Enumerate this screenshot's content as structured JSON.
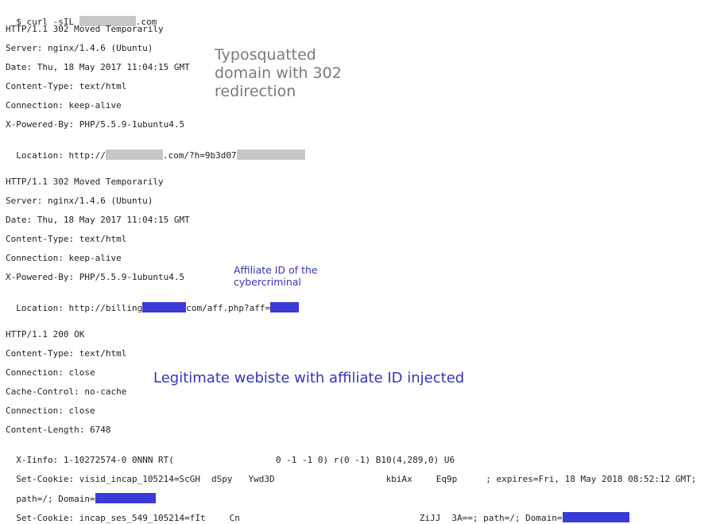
{
  "colors": {
    "redaction_gray": "#c7c7c7",
    "redaction_blue": "#3a3ad6",
    "annotation_blue": "#3535b8",
    "annotation_gray": "#7a7a7a"
  },
  "terminal": {
    "l01a": "$ curl -sIL ",
    "l01b": ".com",
    "l02": "HTTP/1.1 302 Moved Temporarily",
    "l03": "Server: nginx/1.4.6 (Ubuntu)",
    "l04": "Date: Thu, 18 May 2017 11:04:15 GMT",
    "l05": "Content-Type: text/html",
    "l06": "Connection: keep-alive",
    "l07": "X-Powered-By: PHP/5.5.9-1ubuntu4.5",
    "l08a": "Location: http://",
    "l08b": ".com/?h=9b3d07",
    "l09": "HTTP/1.1 302 Moved Temporarily",
    "l10": "Server: nginx/1.4.6 (Ubuntu)",
    "l11": "Date: Thu, 18 May 2017 11:04:15 GMT",
    "l12": "Content-Type: text/html",
    "l13": "Connection: keep-alive",
    "l14": "X-Powered-By: PHP/5.5.9-1ubuntu4.5",
    "l15a": "Location: http://billing",
    "l15b": "com/aff.php?aff=",
    "l16": "HTTP/1.1 200 OK",
    "l17": "Content-Type: text/html",
    "l18": "Connection: close",
    "l19": "Cache-Control: no-cache",
    "l20": "Connection: close",
    "l21": "Content-Length: 6748",
    "l22a": "X-Iinfo: 1-10272574-0 0NNN RT(",
    "l22b": "0 -1 -1 0) r(0 -1) B10(4,289,0) U6",
    "l23a": "Set-Cookie: visid_incap_105214=ScGH",
    "l23b": "dSpy",
    "l23c": "Ywd3D",
    "l23d": "kbiAx",
    "l23e": "Eq9p",
    "l23f": "; expires=Fri, 18 May 2018 08:52:12 GMT;",
    "l24a": "path=/; Domain=",
    "l25a": "Set-Cookie: incap_ses_549_105214=fIt",
    "l25b": "Cn",
    "l25c": "ZiJJ",
    "l25d": "3A==; path=/; Domain="
  },
  "annotations": {
    "typosquat": "Typosquatted\ndomain with 302\nredirection",
    "affiliate": "Affiliate ID of the\ncybercriminal",
    "legit": "Legitimate webiste with affiliate ID injected"
  }
}
